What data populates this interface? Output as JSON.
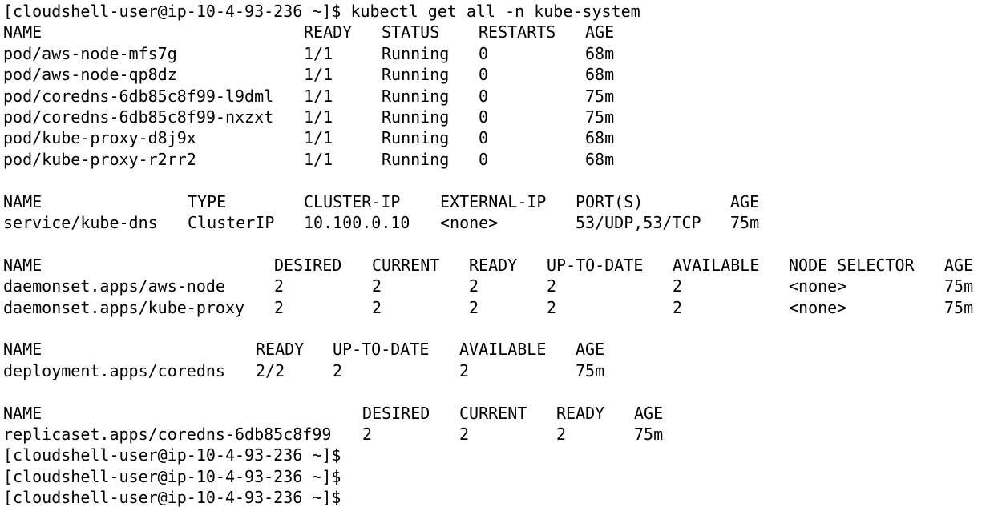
{
  "terminal": {
    "lines": [
      {
        "type": "prompt",
        "prompt": "[cloudshell-user@ip-10-4-93-236 ~]$",
        "command": "kubectl get all -n kube-system"
      },
      {
        "type": "row",
        "cells": [
          "NAME",
          "READY",
          "STATUS",
          "RESTARTS",
          "AGE"
        ]
      },
      {
        "type": "row",
        "cells": [
          "pod/aws-node-mfs7g",
          "1/1",
          "Running",
          "0",
          "68m"
        ]
      },
      {
        "type": "row",
        "cells": [
          "pod/aws-node-qp8dz",
          "1/1",
          "Running",
          "0",
          "68m"
        ]
      },
      {
        "type": "row",
        "cells": [
          "pod/coredns-6db85c8f99-l9dml",
          "1/1",
          "Running",
          "0",
          "75m"
        ]
      },
      {
        "type": "row",
        "cells": [
          "pod/coredns-6db85c8f99-nxzxt",
          "1/1",
          "Running",
          "0",
          "75m"
        ]
      },
      {
        "type": "row",
        "cells": [
          "pod/kube-proxy-d8j9x",
          "1/1",
          "Running",
          "0",
          "68m"
        ]
      },
      {
        "type": "row",
        "cells": [
          "pod/kube-proxy-r2rr2",
          "1/1",
          "Running",
          "0",
          "68m"
        ]
      },
      {
        "type": "blank"
      },
      {
        "type": "row",
        "cells": [
          "NAME",
          "TYPE",
          "CLUSTER-IP",
          "EXTERNAL-IP",
          "PORT(S)",
          "AGE"
        ]
      },
      {
        "type": "row",
        "cells": [
          "service/kube-dns",
          "ClusterIP",
          "10.100.0.10",
          "<none>",
          "53/UDP,53/TCP",
          "75m"
        ]
      },
      {
        "type": "blank"
      },
      {
        "type": "row",
        "cells": [
          "NAME",
          "DESIRED",
          "CURRENT",
          "READY",
          "UP-TO-DATE",
          "AVAILABLE",
          "NODE SELECTOR",
          "AGE"
        ]
      },
      {
        "type": "row",
        "cells": [
          "daemonset.apps/aws-node",
          "2",
          "2",
          "2",
          "2",
          "2",
          "<none>",
          "75m"
        ]
      },
      {
        "type": "row",
        "cells": [
          "daemonset.apps/kube-proxy",
          "2",
          "2",
          "2",
          "2",
          "2",
          "<none>",
          "75m"
        ]
      },
      {
        "type": "blank"
      },
      {
        "type": "row",
        "cells": [
          "NAME",
          "READY",
          "UP-TO-DATE",
          "AVAILABLE",
          "AGE"
        ]
      },
      {
        "type": "row",
        "cells": [
          "deployment.apps/coredns",
          "2/2",
          "2",
          "2",
          "75m"
        ]
      },
      {
        "type": "blank"
      },
      {
        "type": "row",
        "cells": [
          "NAME",
          "DESIRED",
          "CURRENT",
          "READY",
          "AGE"
        ]
      },
      {
        "type": "row",
        "cells": [
          "replicaset.apps/coredns-6db85c8f99",
          "2",
          "2",
          "2",
          "75m"
        ]
      },
      {
        "type": "prompt",
        "prompt": "[cloudshell-user@ip-10-4-93-236 ~]$",
        "command": ""
      },
      {
        "type": "prompt",
        "prompt": "[cloudshell-user@ip-10-4-93-236 ~]$",
        "command": ""
      },
      {
        "type": "prompt",
        "prompt": "[cloudshell-user@ip-10-4-93-236 ~]$",
        "command": ""
      }
    ]
  }
}
